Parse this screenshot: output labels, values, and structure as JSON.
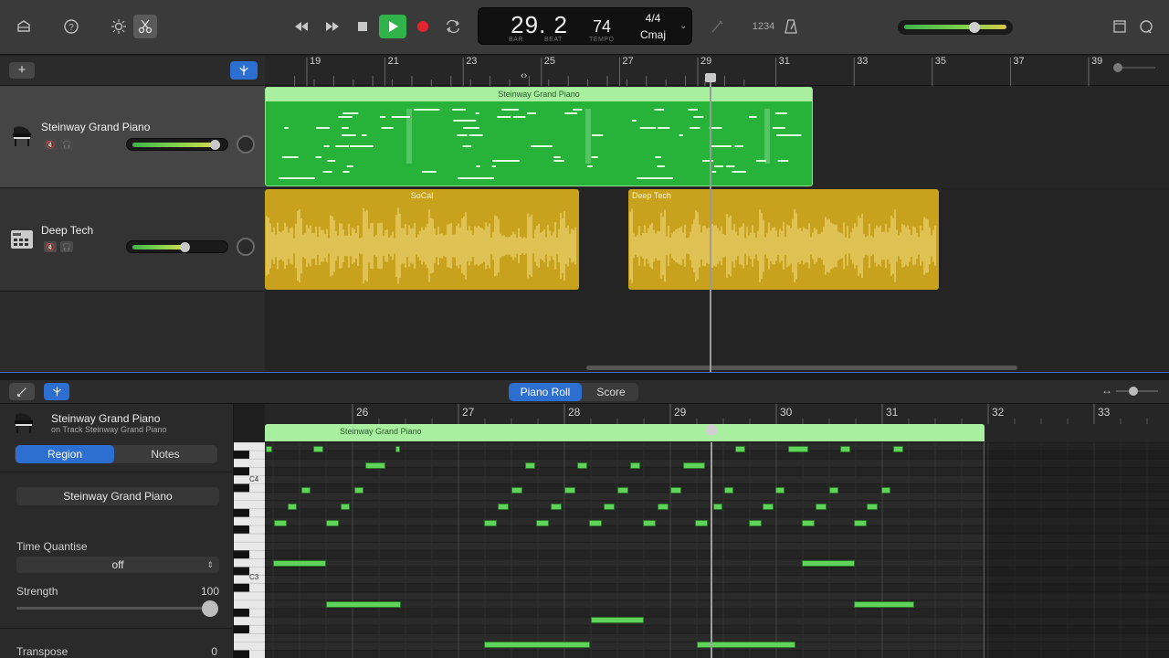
{
  "toolbar": {
    "icons": [
      "library-icon",
      "help-icon",
      "smart-controls-icon",
      "editors-icon",
      "rewind-icon",
      "fast-forward-icon",
      "stop-icon",
      "play-icon",
      "record-icon",
      "cycle-icon",
      "tuner-icon",
      "count-in-icon",
      "metronome-icon",
      "notepad-icon",
      "loop-browser-icon"
    ],
    "count_in_label": "1234",
    "lcd": {
      "position": "29. 2",
      "bar_label": "BAR",
      "beat_label": "BEAT",
      "tempo": "74",
      "tempo_label": "TEMPO",
      "time_signature": "4/4",
      "key": "Cmaj"
    },
    "master_volume": 0.72
  },
  "tracks_ruler": [
    "19",
    "21",
    "23",
    "25",
    "27",
    "29",
    "31",
    "33",
    "35",
    "37",
    "39"
  ],
  "tracks": [
    {
      "name": "Steinway Grand Piano",
      "volume": 0.85,
      "icon": "grand-piano-icon"
    },
    {
      "name": "Deep Tech",
      "volume": 0.55,
      "icon": "drum-machine-icon"
    }
  ],
  "regions": {
    "piano": "Steinway Grand Piano",
    "audio1": "SoCal",
    "audio2": "Deep Tech"
  },
  "piano_roll": {
    "tab_piano_roll": "Piano Roll",
    "tab_score": "Score",
    "ruler": [
      "26",
      "27",
      "28",
      "29",
      "30",
      "31",
      "32",
      "33"
    ],
    "region_label": "Steinway Grand Piano",
    "key_labels": [
      "C4",
      "C3"
    ]
  },
  "inspector": {
    "title": "Steinway Grand Piano",
    "subtitle": "on Track Steinway Grand Piano",
    "seg_region": "Region",
    "seg_notes": "Notes",
    "region_name": "Steinway Grand Piano",
    "time_quantise_label": "Time Quantise",
    "time_quantise_value": "off",
    "strength_label": "Strength",
    "strength_value": "100",
    "transpose_label": "Transpose",
    "transpose_value": "0"
  },
  "colors": {
    "piano_region": "#27b33a",
    "audio_region": "#c9a21d",
    "accent_blue": "#2d6fd0"
  }
}
